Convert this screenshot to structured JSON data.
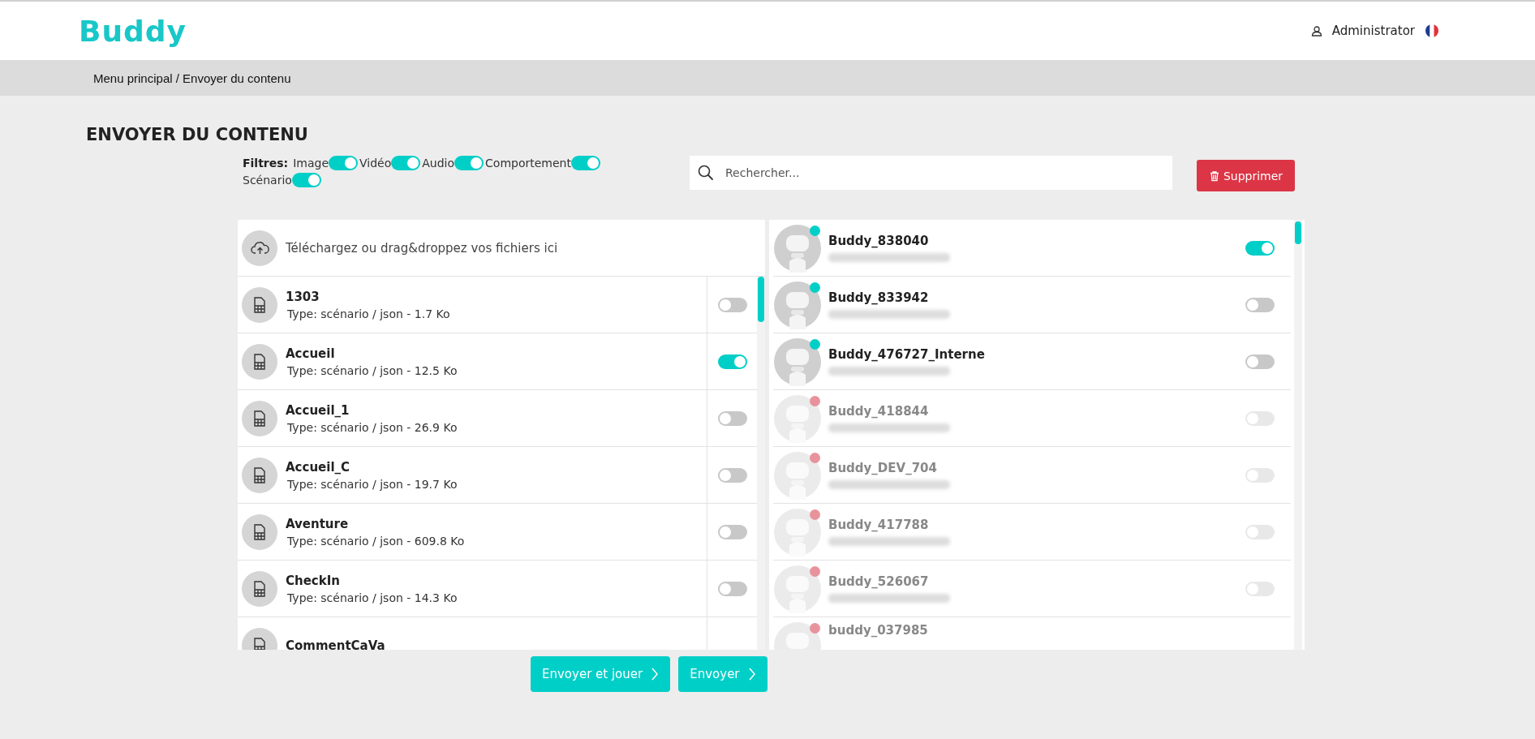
{
  "header": {
    "logo": "Buddy",
    "user": "Administrator"
  },
  "breadcrumb": "Menu principal / Envoyer du contenu",
  "page_title": "ENVOYER DU CONTENU",
  "filters": {
    "label": "Filtres:",
    "items": [
      {
        "label": "Image",
        "on": true
      },
      {
        "label": "Vidéo",
        "on": true
      },
      {
        "label": "Audio",
        "on": true
      },
      {
        "label": "Comportement",
        "on": true
      },
      {
        "label": "Scénario",
        "on": true
      }
    ]
  },
  "search": {
    "placeholder": "Rechercher..."
  },
  "delete_button": "Supprimer",
  "upload": {
    "text": "Téléchargez ou drag&droppez vos fichiers ici"
  },
  "files": [
    {
      "name": "1303",
      "info": "Type: scénario / json - 1.7 Ko",
      "on": false
    },
    {
      "name": "Accueil",
      "info": "Type: scénario / json - 12.5 Ko",
      "on": true
    },
    {
      "name": "Accueil_1",
      "info": "Type: scénario / json - 26.9 Ko",
      "on": false
    },
    {
      "name": "Accueil_C",
      "info": "Type: scénario / json - 19.7 Ko",
      "on": false
    },
    {
      "name": "Aventure",
      "info": "Type: scénario / json - 609.8 Ko",
      "on": false
    },
    {
      "name": "CheckIn",
      "info": "Type: scénario / json - 14.3 Ko",
      "on": false
    },
    {
      "name": "CommentCaVa"
    }
  ],
  "robots": [
    {
      "name": "Buddy_838040",
      "color": "#00cfc8",
      "disabled": false,
      "on": true
    },
    {
      "name": "Buddy_833942",
      "color": "#00cfc8",
      "disabled": false,
      "on": false
    },
    {
      "name": "Buddy_476727_Interne",
      "color": "#00cfc8",
      "disabled": false,
      "on": false
    },
    {
      "name": "Buddy_418844",
      "color": "#e8939c",
      "disabled": true,
      "on": false
    },
    {
      "name": "Buddy_DEV_704",
      "color": "#e8939c",
      "disabled": true,
      "on": false
    },
    {
      "name": "Buddy_417788",
      "color": "#e8939c",
      "disabled": true,
      "on": false
    },
    {
      "name": "Buddy_526067",
      "color": "#e8939c",
      "disabled": true,
      "on": false
    },
    {
      "name": "buddy_037985",
      "color": "#e8939c",
      "disabled": true
    }
  ],
  "actions": [
    "Envoyer et jouer",
    "Envoyer"
  ]
}
